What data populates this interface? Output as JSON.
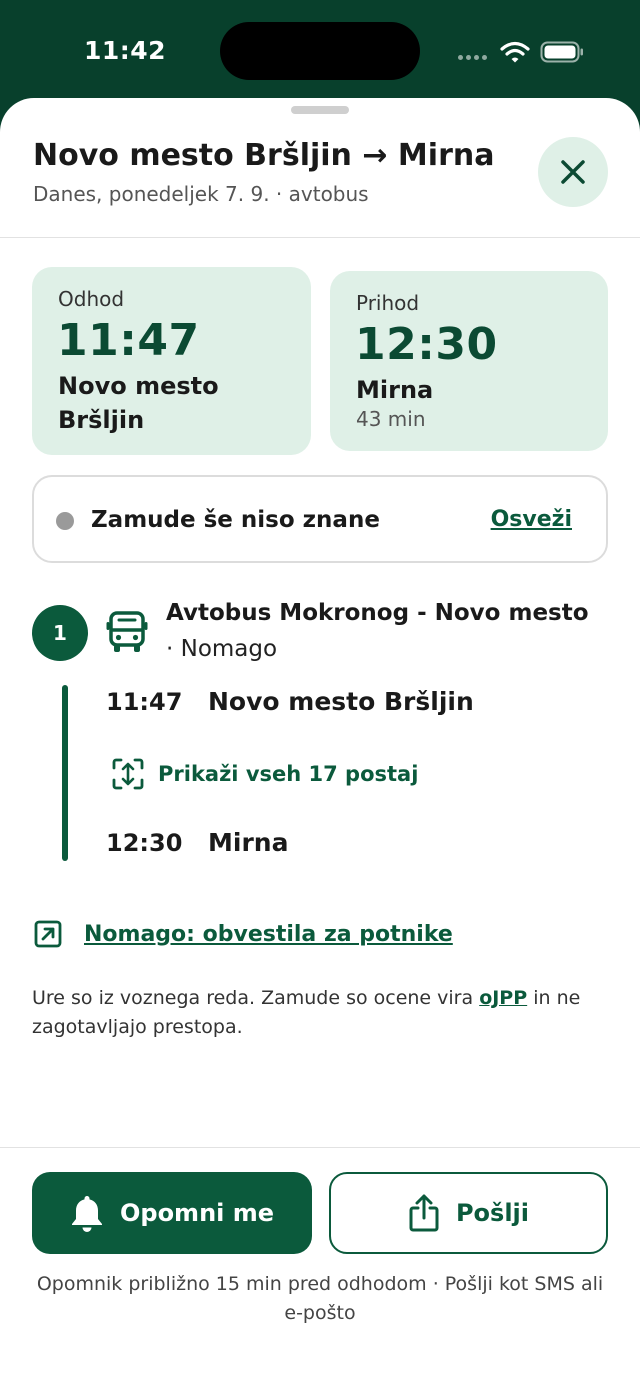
{
  "status": {
    "time": "11:42"
  },
  "header": {
    "title": "Novo mesto Bršljin → Mirna",
    "subtitle": "Danes, ponedeljek 7. 9. · avtobus"
  },
  "departure": {
    "label": "Odhod",
    "time": "11:47",
    "stop": "Novo mesto Bršljin"
  },
  "arrival": {
    "label": "Prihod",
    "time": "12:30",
    "stop": "Mirna",
    "duration": "43 min"
  },
  "delay": {
    "text": "Zamude še niso znane",
    "refresh_label": "Osveži"
  },
  "leg": {
    "number": "1",
    "title": "Avtobus Mokronog - Novo mesto",
    "operator": "· Nomago",
    "stops": [
      {
        "time": "11:47",
        "name": "Novo mesto Bršljin"
      },
      {
        "time": "12:30",
        "name": "Mirna"
      }
    ],
    "show_all_label": "Prikaži vseh 17 postaj"
  },
  "notice_link": "Nomago: obvestila za potnike",
  "footnote": {
    "before": "Ure so iz voznega reda. Zamude so ocene vira ",
    "source": "oJPP",
    "after": " in ne zagotavljajo prestopa."
  },
  "actions": {
    "remind_label": "Opomni me",
    "send_label": "Pošlji",
    "note": "Opomnik približno 15 min pred odhodom · Pošlji kot SMS ali e-pošto"
  },
  "colors": {
    "primary": "#0b5a3c",
    "card_bg": "#dff0e7",
    "top_bg": "#08402c"
  },
  "icons": [
    "close-icon",
    "bus-icon",
    "expand-icon",
    "external-link-icon",
    "bell-icon",
    "share-icon",
    "wifi-icon",
    "battery-icon"
  ]
}
